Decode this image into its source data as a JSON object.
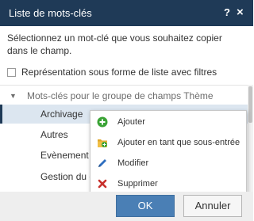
{
  "dialog": {
    "title": "Liste de mots-clés",
    "help_label": "?",
    "close_label": "×"
  },
  "instruction": "Sélectionnez un mot-clé que vous souhaitez copier dans le champ.",
  "list_filter_checkbox": {
    "label": "Représentation sous forme de liste avec filtres",
    "checked": false
  },
  "tree": {
    "group_label": "Mots-clés pour le groupe de champs Thème",
    "expanded": true,
    "items": [
      {
        "label": "Archivage",
        "selected": true
      },
      {
        "label": "Autres",
        "selected": false
      },
      {
        "label": "Evènement",
        "selected": false
      },
      {
        "label": "Gestion du c",
        "selected": false
      }
    ]
  },
  "context_menu": {
    "items": [
      {
        "label": "Ajouter",
        "icon": "add-circle-icon",
        "color": "#3aa335"
      },
      {
        "label": "Ajouter en tant que sous-entrée",
        "icon": "add-subentry-icon",
        "color": "#e0a526"
      },
      {
        "label": "Modifier",
        "icon": "pencil-icon",
        "color": "#2f6fc0"
      },
      {
        "label": "Supprimer",
        "icon": "delete-x-icon",
        "color": "#c8302c"
      }
    ]
  },
  "buttons": {
    "ok_label": "OK",
    "cancel_label": "Annuler"
  },
  "colors": {
    "titlebar": "#1f3a57",
    "primary_button": "#4a7fb5",
    "selection": "#dce6f0"
  }
}
